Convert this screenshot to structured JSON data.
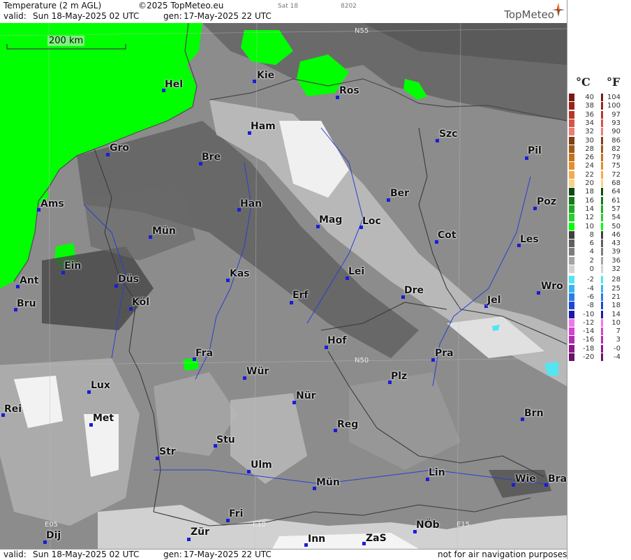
{
  "header": {
    "product": "Temperature (2 m AGL)",
    "copyright": "©2025 TopMeteo.eu",
    "day_tab": "Sat 18",
    "code": "8202",
    "valid_label": "valid:",
    "valid_value": "Sun  18-May-2025  02 UTC",
    "gen_label": "gen:",
    "gen_value": "17-May-2025 22 UTC",
    "logo_text": "TopMeteo"
  },
  "footer": {
    "valid_label": "valid:",
    "valid_value": "Sun  18-May-2025  02 UTC",
    "gen_label": "gen:",
    "gen_value": "17-May-2025 22 UTC",
    "disclaimer": "not for air navigation purposes"
  },
  "map": {
    "scale_label": "200 km",
    "grid_labels": [
      "N55",
      "N50",
      "E05",
      "E10",
      "E15"
    ],
    "cities": [
      "Hel",
      "Kie",
      "Ros",
      "Ham",
      "Szc",
      "Gro",
      "Bre",
      "Pil",
      "Ber",
      "Ams",
      "Han",
      "Poz",
      "Mag",
      "Loc",
      "Mün",
      "Cot",
      "Les",
      "Ein",
      "Kas",
      "Lei",
      "Ant",
      "Düs",
      "Wro",
      "Dre",
      "Bru",
      "Erf",
      "Köl",
      "Jel",
      "Hof",
      "Fra",
      "Pra",
      "Lux",
      "Wür",
      "Plz",
      "Rei",
      "Nür",
      "Met",
      "Reg",
      "Brn",
      "Stu",
      "Str",
      "Ulm",
      "Lin",
      "Wie",
      "Bra",
      "Mün",
      "Fri",
      "NÖb",
      "Dij",
      "Zür",
      "Inn",
      "ZaS"
    ],
    "colors": {
      "land_gray": "#8c8c8c",
      "green": "#00ff00",
      "city_marker": "#1c1cd8",
      "river": "#2840d0"
    }
  },
  "legend": {
    "unit_c": "°C",
    "unit_f": "°F",
    "rows": [
      {
        "c": "40",
        "f": "104",
        "color": "#7a1a12"
      },
      {
        "c": "38",
        "f": "100",
        "color": "#9b241a"
      },
      {
        "c": "36",
        "f": "97",
        "color": "#b8372a"
      },
      {
        "c": "34",
        "f": "93",
        "color": "#d6544a"
      },
      {
        "c": "32",
        "f": "90",
        "color": "#ea7d76"
      },
      {
        "c": "30",
        "f": "86",
        "color": "#7e4210"
      },
      {
        "c": "28",
        "f": "82",
        "color": "#a25a14"
      },
      {
        "c": "26",
        "f": "79",
        "color": "#c5731c"
      },
      {
        "c": "24",
        "f": "75",
        "color": "#e48f2c"
      },
      {
        "c": "22",
        "f": "72",
        "color": "#f4ab50"
      },
      {
        "c": "20",
        "f": "68",
        "color": "#fccf8a"
      },
      {
        "c": "18",
        "f": "64",
        "color": "#0f4a12"
      },
      {
        "c": "16",
        "f": "61",
        "color": "#157a17"
      },
      {
        "c": "14",
        "f": "57",
        "color": "#1eab20"
      },
      {
        "c": "12",
        "f": "54",
        "color": "#27d22a"
      },
      {
        "c": "10",
        "f": "50",
        "color": "#00ff00"
      },
      {
        "c": "8",
        "f": "46",
        "color": "#404040"
      },
      {
        "c": "6",
        "f": "43",
        "color": "#5f5f5f"
      },
      {
        "c": "4",
        "f": "39",
        "color": "#7d7d7d"
      },
      {
        "c": "2",
        "f": "36",
        "color": "#a4a4a4"
      },
      {
        "c": "0",
        "f": "32",
        "color": "#d2d2d2"
      },
      {
        "c": "-2",
        "f": "28",
        "color": "#52e6f2"
      },
      {
        "c": "-4",
        "f": "25",
        "color": "#38b6ee"
      },
      {
        "c": "-6",
        "f": "21",
        "color": "#2c7de6"
      },
      {
        "c": "-8",
        "f": "18",
        "color": "#1b48d6"
      },
      {
        "c": "-10",
        "f": "14",
        "color": "#1a1aa8"
      },
      {
        "c": "-12",
        "f": "10",
        "color": "#f078e8"
      },
      {
        "c": "-14",
        "f": "7",
        "color": "#d841d4"
      },
      {
        "c": "-16",
        "f": "3",
        "color": "#b42cae"
      },
      {
        "c": "-18",
        "f": "-0",
        "color": "#8c1a88"
      },
      {
        "c": "-20",
        "f": "-4",
        "color": "#68126a"
      }
    ]
  }
}
